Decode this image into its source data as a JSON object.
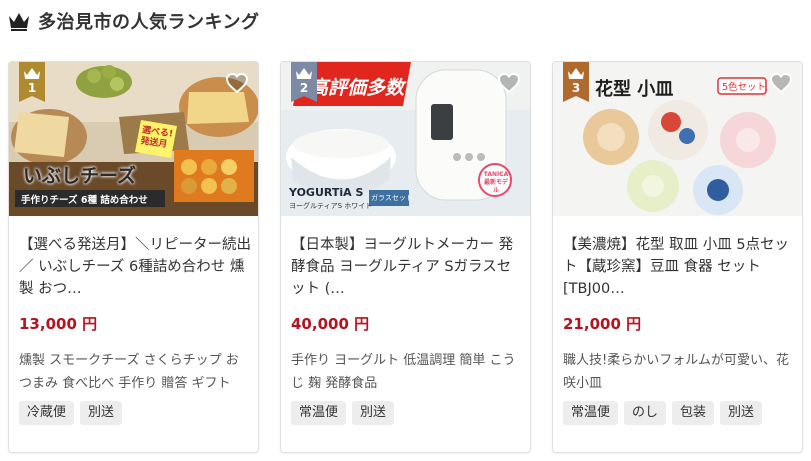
{
  "header": {
    "title": "多治見市の人気ランキング",
    "icon": "crown-icon"
  },
  "colors": {
    "rank1": "#b08a2e",
    "rank2": "#7c8aa6",
    "rank3": "#b06a2e",
    "price": "#b4141e",
    "tag_bg": "#ededed"
  },
  "cards": [
    {
      "rank": "1",
      "image_text": {
        "main": "いぶしチーズ",
        "banner": "手作りチーズ 6種 詰め合わせ",
        "badge": "選べる!発送月"
      },
      "title": "【選べる発送月】＼リピーター続出／ いぶしチーズ 6種詰め合わせ 燻製 おつ…",
      "price": "13,000 円",
      "description": "燻製 スモークチーズ さくらチップ おつまみ 食べ比べ 手作り 贈答 ギフト",
      "tags": [
        "冷蔵便",
        "別送"
      ]
    },
    {
      "rank": "2",
      "image_text": {
        "main": "高評価多数",
        "brand": "YOGURTiA S",
        "sub": "ヨーグルティアS ホワイト",
        "glass": "ガラスセット",
        "badge": "TANICA 最新モデル"
      },
      "title": "【日本製】ヨーグルトメーカー 発酵食品 ヨーグルティア Sガラスセット (…",
      "price": "40,000 円",
      "description": "手作り ヨーグルト 低温調理 簡単 こうじ 麹 発酵食品",
      "tags": [
        "常温便",
        "別送"
      ]
    },
    {
      "rank": "3",
      "image_text": {
        "main": "花型 小皿",
        "badge": "5色セット"
      },
      "title": "【美濃焼】花型 取皿 小皿 5点セット【蔵珍窯】豆皿 食器 セット [TBJ00…",
      "price": "21,000 円",
      "description": "職人技!柔らかいフォルムが可愛い、花咲小皿",
      "tags": [
        "常温便",
        "のし",
        "包装",
        "別送"
      ]
    }
  ]
}
